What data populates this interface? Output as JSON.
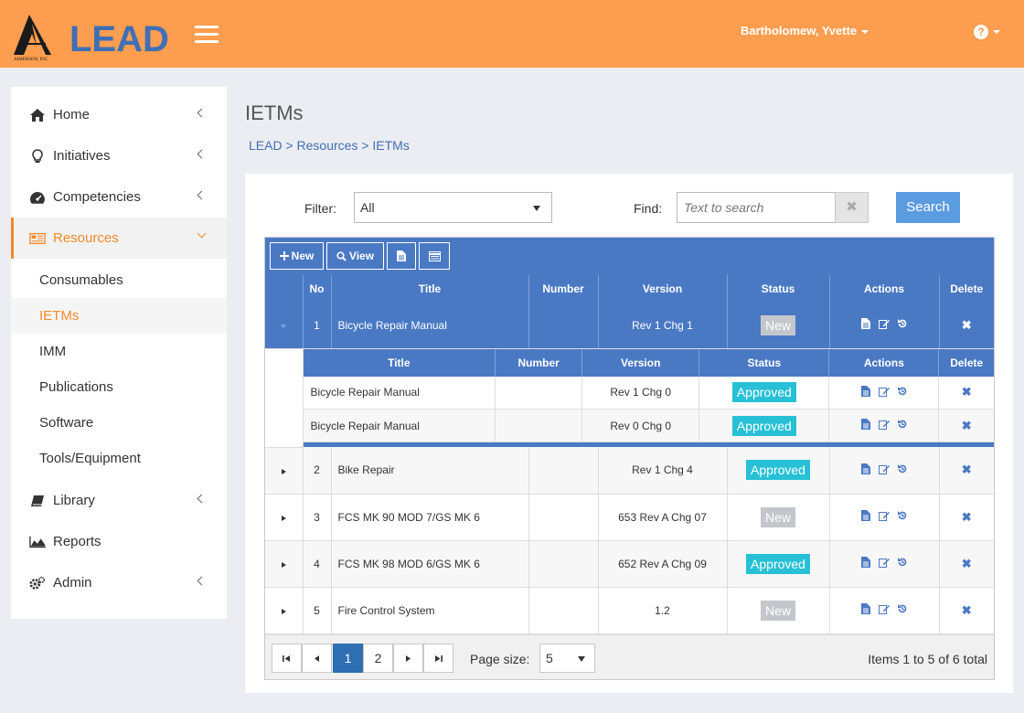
{
  "header": {
    "logo_text": "LEAD",
    "logo_subtext": "AIMERSON, INC.",
    "user_name": "Bartholomew, Yvette",
    "help_glyph": "?",
    "accent": "#fd9d4f"
  },
  "sidebar": {
    "items": [
      {
        "label": "Home",
        "icon": "home-icon"
      },
      {
        "label": "Initiatives",
        "icon": "lightbulb-icon"
      },
      {
        "label": "Competencies",
        "icon": "dashboard-icon"
      },
      {
        "label": "Resources",
        "icon": "resources-icon"
      },
      {
        "label": "Library",
        "icon": "book-icon"
      },
      {
        "label": "Reports",
        "icon": "area-chart-icon"
      },
      {
        "label": "Admin",
        "icon": "gears-icon"
      }
    ],
    "sub_items": [
      "Consumables",
      "IETMs",
      "IMM",
      "Publications",
      "Software",
      "Tools/Equipment"
    ],
    "active_item": "Resources",
    "active_sub_item": "IETMs"
  },
  "page": {
    "title": "IETMs",
    "breadcrumb": "LEAD > Resources > IETMs"
  },
  "filter": {
    "label": "Filter:",
    "value": "All",
    "find_label": "Find:",
    "find_placeholder": "Text to search",
    "clear_glyph": "✖",
    "search_label": "Search"
  },
  "toolbar": {
    "new_label": "New",
    "view_label": "View"
  },
  "grid": {
    "columns": [
      "No",
      "Title",
      "Number",
      "Version",
      "Status",
      "Actions",
      "Delete"
    ],
    "sub_columns": [
      "Title",
      "Number",
      "Version",
      "Status",
      "Actions",
      "Delete"
    ],
    "delete_glyph": "✖",
    "rows": [
      {
        "no": "1",
        "title": "Bicycle Repair Manual",
        "number": "",
        "version": "Rev 1 Chg 1",
        "status": "New"
      },
      {
        "no": "2",
        "title": "Bike Repair",
        "number": "",
        "version": "Rev 1 Chg 4",
        "status": "Approved"
      },
      {
        "no": "3",
        "title": "FCS MK 90 MOD 7/GS MK 6",
        "number": "",
        "version": "653 Rev A Chg 07",
        "status": "New"
      },
      {
        "no": "4",
        "title": "FCS MK 98 MOD 6/GS MK 6",
        "number": "",
        "version": "652 Rev A Chg 09",
        "status": "Approved"
      },
      {
        "no": "5",
        "title": "Fire Control System",
        "number": "",
        "version": "1.2",
        "status": "New"
      }
    ],
    "sub_rows": [
      {
        "title": "Bicycle Repair Manual",
        "number": "",
        "version": "Rev 1 Chg 0",
        "status": "Approved"
      },
      {
        "title": "Bicycle Repair Manual",
        "number": "",
        "version": "Rev 0 Chg 0",
        "status": "Approved"
      }
    ]
  },
  "pager": {
    "pages": [
      "1",
      "2"
    ],
    "current_page": "1",
    "page_size_label": "Page size:",
    "page_size": "5",
    "info": "Items 1 to 5 of 6 total"
  }
}
